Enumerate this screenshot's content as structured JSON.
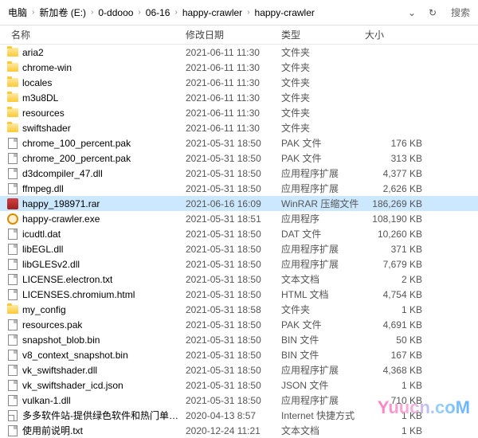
{
  "breadcrumb": [
    "电脑",
    "新加卷 (E:)",
    "0-ddooo",
    "06-16",
    "happy-crawler",
    "happy-crawler"
  ],
  "search_label": "搜索",
  "columns": {
    "name": "名称",
    "date": "修改日期",
    "type": "类型",
    "size": "大小"
  },
  "files": [
    {
      "icon": "folder",
      "name": "aria2",
      "date": "2021-06-11 11:30",
      "type": "文件夹",
      "size": ""
    },
    {
      "icon": "folder",
      "name": "chrome-win",
      "date": "2021-06-11 11:30",
      "type": "文件夹",
      "size": ""
    },
    {
      "icon": "folder",
      "name": "locales",
      "date": "2021-06-11 11:30",
      "type": "文件夹",
      "size": ""
    },
    {
      "icon": "folder",
      "name": "m3u8DL",
      "date": "2021-06-11 11:30",
      "type": "文件夹",
      "size": ""
    },
    {
      "icon": "folder",
      "name": "resources",
      "date": "2021-06-11 11:30",
      "type": "文件夹",
      "size": ""
    },
    {
      "icon": "folder",
      "name": "swiftshader",
      "date": "2021-06-11 11:30",
      "type": "文件夹",
      "size": ""
    },
    {
      "icon": "file",
      "name": "chrome_100_percent.pak",
      "date": "2021-05-31 18:50",
      "type": "PAK 文件",
      "size": "176 KB"
    },
    {
      "icon": "file",
      "name": "chrome_200_percent.pak",
      "date": "2021-05-31 18:50",
      "type": "PAK 文件",
      "size": "313 KB"
    },
    {
      "icon": "file",
      "name": "d3dcompiler_47.dll",
      "date": "2021-05-31 18:50",
      "type": "应用程序扩展",
      "size": "4,377 KB"
    },
    {
      "icon": "file",
      "name": "ffmpeg.dll",
      "date": "2021-05-31 18:50",
      "type": "应用程序扩展",
      "size": "2,626 KB"
    },
    {
      "icon": "rar",
      "name": "happy_198971.rar",
      "date": "2021-06-16 16:09",
      "type": "WinRAR 压缩文件",
      "size": "186,269 KB",
      "selected": true
    },
    {
      "icon": "gear",
      "name": "happy-crawler.exe",
      "date": "2021-05-31 18:51",
      "type": "应用程序",
      "size": "108,190 KB"
    },
    {
      "icon": "file",
      "name": "icudtl.dat",
      "date": "2021-05-31 18:50",
      "type": "DAT 文件",
      "size": "10,260 KB"
    },
    {
      "icon": "file",
      "name": "libEGL.dll",
      "date": "2021-05-31 18:50",
      "type": "应用程序扩展",
      "size": "371 KB"
    },
    {
      "icon": "file",
      "name": "libGLESv2.dll",
      "date": "2021-05-31 18:50",
      "type": "应用程序扩展",
      "size": "7,679 KB"
    },
    {
      "icon": "file",
      "name": "LICENSE.electron.txt",
      "date": "2021-05-31 18:50",
      "type": "文本文档",
      "size": "2 KB"
    },
    {
      "icon": "file",
      "name": "LICENSES.chromium.html",
      "date": "2021-05-31 18:50",
      "type": "HTML 文档",
      "size": "4,754 KB"
    },
    {
      "icon": "folder",
      "name": "my_config",
      "date": "2021-05-31 18:58",
      "type": "文件夹",
      "size": "1 KB"
    },
    {
      "icon": "file",
      "name": "resources.pak",
      "date": "2021-05-31 18:50",
      "type": "PAK 文件",
      "size": "4,691 KB"
    },
    {
      "icon": "file",
      "name": "snapshot_blob.bin",
      "date": "2021-05-31 18:50",
      "type": "BIN 文件",
      "size": "50 KB"
    },
    {
      "icon": "file",
      "name": "v8_context_snapshot.bin",
      "date": "2021-05-31 18:50",
      "type": "BIN 文件",
      "size": "167 KB"
    },
    {
      "icon": "file",
      "name": "vk_swiftshader.dll",
      "date": "2021-05-31 18:50",
      "type": "应用程序扩展",
      "size": "4,368 KB"
    },
    {
      "icon": "file",
      "name": "vk_swiftshader_icd.json",
      "date": "2021-05-31 18:50",
      "type": "JSON 文件",
      "size": "1 KB"
    },
    {
      "icon": "file",
      "name": "vulkan-1.dll",
      "date": "2021-05-31 18:50",
      "type": "应用程序扩展",
      "size": "710 KB"
    },
    {
      "icon": "link",
      "name": "多多软件站-提供绿色软件和热门单机游...",
      "date": "2020-04-13 8:57",
      "type": "Internet 快捷方式",
      "size": "1 KB"
    },
    {
      "icon": "file",
      "name": "使用前说明.txt",
      "date": "2020-12-24 11:21",
      "type": "文本文档",
      "size": "1 KB"
    }
  ],
  "watermark": "Yuucn.coM"
}
